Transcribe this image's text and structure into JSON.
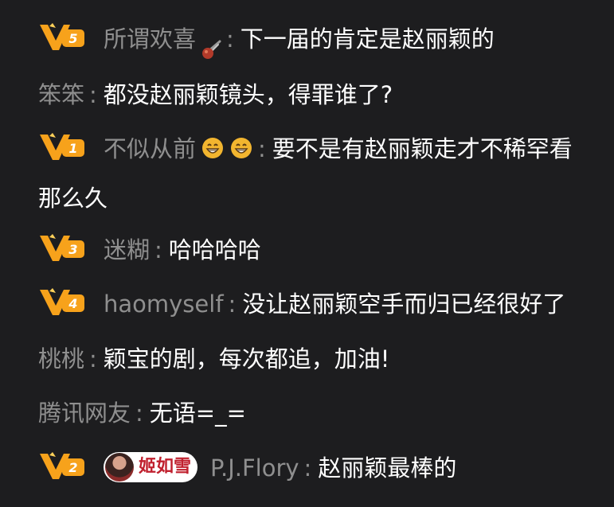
{
  "comments": [
    {
      "name": "所谓欢喜",
      "sep": ":",
      "text": "下一届的肯定是赵丽颖的",
      "level": "5",
      "decor": "meteor"
    },
    {
      "name": "笨笨",
      "sep": ":",
      "text": "都没赵丽颖镜头，得罪谁了?",
      "level": "",
      "decor": ""
    },
    {
      "name": "不似从前",
      "sep": ":",
      "text": "要不是有赵丽颖走才不稀罕看那么久",
      "level": "1",
      "decor": "grin-x2"
    },
    {
      "name": "迷糊",
      "sep": ":",
      "text": "哈哈哈哈",
      "level": "3",
      "decor": ""
    },
    {
      "name": "haomyself",
      "sep": ":",
      "text": "没让赵丽颖空手而归已经很好了",
      "level": "4",
      "decor": ""
    },
    {
      "name": "桃桃",
      "sep": ":",
      "text": "颖宝的剧，每次都追，加油!",
      "level": "",
      "decor": ""
    },
    {
      "name": "腾讯网友",
      "sep": ":",
      "text": "无语=_=",
      "level": "",
      "decor": ""
    },
    {
      "name": "P.J.Flory",
      "sep": ":",
      "text": "赵丽颖最棒的",
      "level": "2",
      "decor": "fan-medal",
      "medal_label": "姬如雪"
    }
  ],
  "colors": {
    "background": "#1d1d1f",
    "name": "#8f8f8f",
    "text": "#ffffff",
    "badge_orange": "#f7a21b",
    "medal_red": "#c0202e"
  },
  "icons": {
    "vip_badge": "vip-level-badge-icon",
    "meteor": "meteor-icon",
    "grin": "grinning-face-icon",
    "medal_avatar": "fan-medal-avatar"
  }
}
